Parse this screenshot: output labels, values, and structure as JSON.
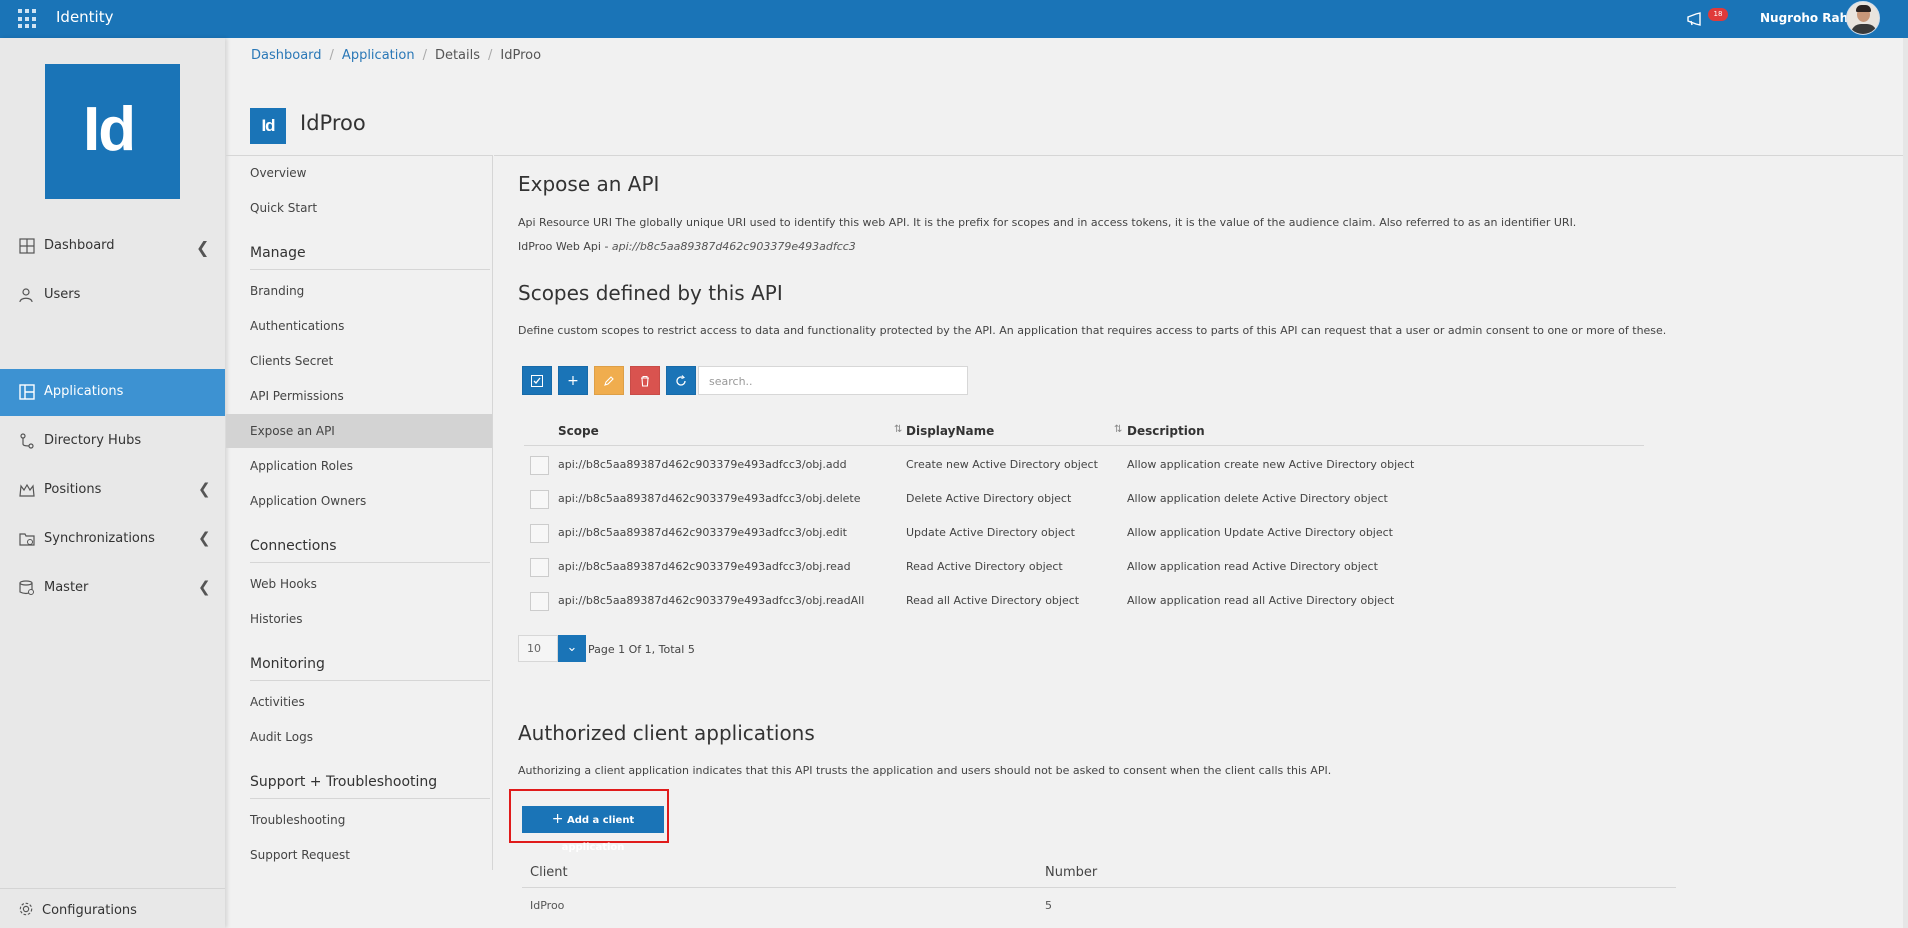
{
  "topbar": {
    "app_title": "Identity",
    "notification_count": "18",
    "user_name": "Nugroho Rah"
  },
  "sidebar": {
    "logo_text": "Id",
    "items": [
      {
        "label": "Dashboard",
        "icon": "dashboard-icon"
      },
      {
        "label": "Users",
        "icon": "users-icon"
      },
      {
        "label": "Applications",
        "icon": "applications-icon"
      },
      {
        "label": "Directory Hubs",
        "icon": "directory-hubs-icon"
      },
      {
        "label": "Positions",
        "icon": "positions-icon"
      },
      {
        "label": "Synchronizations",
        "icon": "synchronizations-icon"
      },
      {
        "label": "Master",
        "icon": "master-icon"
      }
    ],
    "configurations_label": "Configurations"
  },
  "breadcrumb": {
    "items": [
      "Dashboard",
      "Application",
      "Details",
      "IdProo"
    ]
  },
  "app": {
    "badge": "Id",
    "name": "IdProo"
  },
  "subnav": {
    "overview": "Overview",
    "quick_start": "Quick Start",
    "manage_title": "Manage",
    "manage_items": [
      "Branding",
      "Authentications",
      "Clients Secret",
      "API Permissions",
      "Expose an API",
      "Application Roles",
      "Application Owners"
    ],
    "connections_title": "Connections",
    "connections_items": [
      "Web Hooks",
      "Histories"
    ],
    "monitoring_title": "Monitoring",
    "monitoring_items": [
      "Activities",
      "Audit Logs"
    ],
    "support_title": "Support + Troubleshooting",
    "support_items": [
      "Troubleshooting",
      "Support Request"
    ]
  },
  "expose": {
    "title": "Expose an API",
    "description": "Api Resource URI The globally unique URI used to identify this web API. It is the prefix for scopes and in access tokens, it is the value of the audience claim. Also referred to as an identifier URI.",
    "uri_label": "IdProo Web Api - ",
    "uri_value": "api://b8c5aa89387d462c903379e493adfcc3"
  },
  "scopes": {
    "title": "Scopes defined by this API",
    "description": "Define custom scopes to restrict access to data and functionality protected by the API. An application that requires access to parts of this API can request that a user or admin consent to one or more of these.",
    "search_placeholder": "search..",
    "columns": [
      "Scope",
      "DisplayName",
      "Description"
    ],
    "rows": [
      {
        "scope": "api://b8c5aa89387d462c903379e493adfcc3/obj.add",
        "display": "Create new Active Directory object",
        "description": "Allow application create new Active Directory object"
      },
      {
        "scope": "api://b8c5aa89387d462c903379e493adfcc3/obj.delete",
        "display": "Delete Active Directory object",
        "description": "Allow application delete Active Directory object"
      },
      {
        "scope": "api://b8c5aa89387d462c903379e493adfcc3/obj.edit",
        "display": "Update Active Directory object",
        "description": "Allow application Update Active Directory object"
      },
      {
        "scope": "api://b8c5aa89387d462c903379e493adfcc3/obj.read",
        "display": "Read Active Directory object",
        "description": "Allow application read Active Directory object"
      },
      {
        "scope": "api://b8c5aa89387d462c903379e493adfcc3/obj.readAll",
        "display": "Read all Active Directory object",
        "description": "Allow application read all Active Directory object"
      }
    ],
    "page_size": "10",
    "page_info": "Page 1 Of 1, Total 5"
  },
  "authorized": {
    "title": "Authorized client applications",
    "description": "Authorizing a client application indicates that this API trusts the application and users should not be asked to consent when the client calls this API.",
    "add_button": "Add a client application",
    "columns": [
      "Client",
      "Number"
    ],
    "rows": [
      {
        "client": "IdProo",
        "number": "5"
      }
    ]
  },
  "colors": {
    "primary": "#1a74b7",
    "active_nav": "#3d92d2",
    "edit": "#f0ad4e",
    "delete": "#d9534f",
    "highlight_frame": "#e01b1b"
  }
}
